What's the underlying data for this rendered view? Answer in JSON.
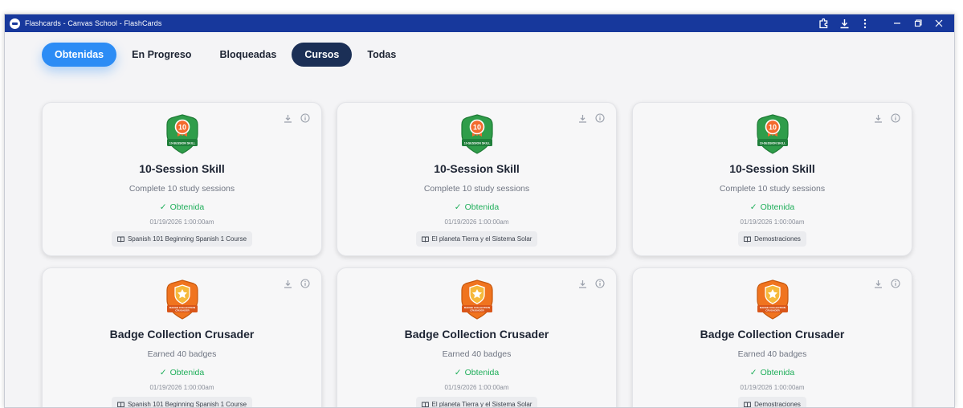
{
  "window": {
    "title": "Flashcards - Canvas School - FlashCards"
  },
  "titlebar_icons": [
    "extension-icon",
    "download-icon",
    "more-icon",
    "minimize-icon",
    "restore-icon",
    "close-icon"
  ],
  "tabs": [
    {
      "label": "Obtenidas",
      "state": "active-blue"
    },
    {
      "label": "En Progreso",
      "state": ""
    },
    {
      "label": "Bloqueadas",
      "state": ""
    },
    {
      "label": "Cursos",
      "state": "active-dark"
    },
    {
      "label": "Todas",
      "state": ""
    }
  ],
  "colors": {
    "titlebar": "#17389c",
    "tab_active": "#2c8cf5",
    "tab_courses": "#1b2f56",
    "earned": "#1fae5a"
  },
  "badges": {
    "skill": {
      "number": "10",
      "ribbon": "10-SESSION SKILL"
    },
    "crusader": {
      "ribbon": "BADGE COLLECTION CRUSADER"
    }
  },
  "cards": [
    {
      "badge": "skill",
      "title": "10-Session Skill",
      "description": "Complete 10 study sessions",
      "status": "Obtenida",
      "date": "01/19/2026 1:00:00am",
      "course": "Spanish 101 Beginning Spanish 1 Course"
    },
    {
      "badge": "skill",
      "title": "10-Session Skill",
      "description": "Complete 10 study sessions",
      "status": "Obtenida",
      "date": "01/19/2026 1:00:00am",
      "course": "El planeta Tierra y el Sistema Solar"
    },
    {
      "badge": "skill",
      "title": "10-Session Skill",
      "description": "Complete 10 study sessions",
      "status": "Obtenida",
      "date": "01/19/2026 1:00:00am",
      "course": "Demostraciones"
    },
    {
      "badge": "crusader",
      "title": "Badge Collection Crusader",
      "description": "Earned 40 badges",
      "status": "Obtenida",
      "date": "01/19/2026 1:00:00am",
      "course": "Spanish 101 Beginning Spanish 1 Course"
    },
    {
      "badge": "crusader",
      "title": "Badge Collection Crusader",
      "description": "Earned 40 badges",
      "status": "Obtenida",
      "date": "01/19/2026 1:00:00am",
      "course": "El planeta Tierra y el Sistema Solar"
    },
    {
      "badge": "crusader",
      "title": "Badge Collection Crusader",
      "description": "Earned 40 badges",
      "status": "Obtenida",
      "date": "01/19/2026 1:00:00am",
      "course": "Demostraciones"
    }
  ]
}
